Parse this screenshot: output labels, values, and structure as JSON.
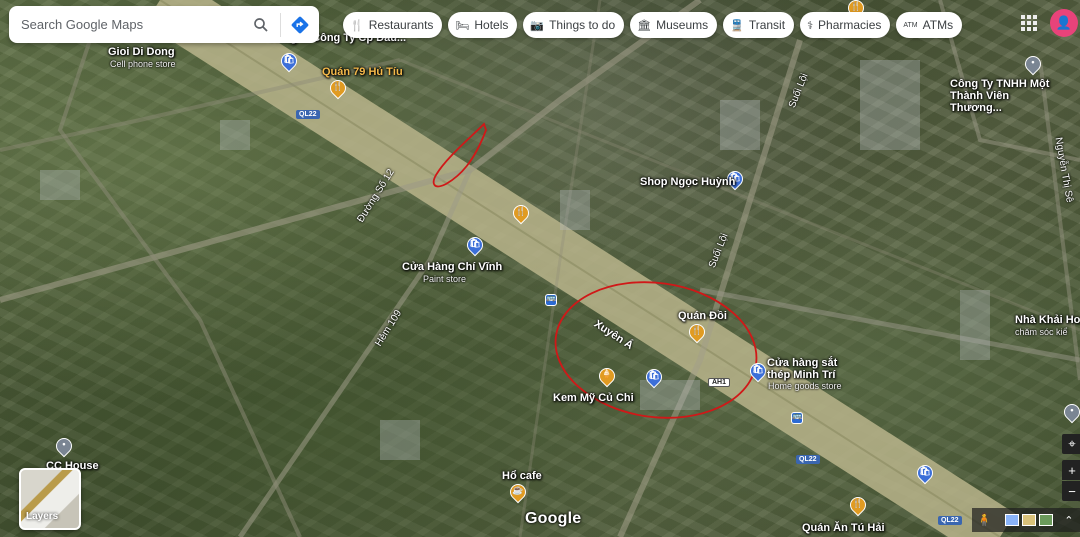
{
  "search": {
    "value": "Search Google Maps"
  },
  "chips": [
    {
      "label": "Restaurants",
      "icon": "fork-knife-icon",
      "glyph": "🍴"
    },
    {
      "label": "Hotels",
      "icon": "bed-icon",
      "glyph": "🛏"
    },
    {
      "label": "Things to do",
      "icon": "camera-icon",
      "glyph": "📷"
    },
    {
      "label": "Museums",
      "icon": "museum-icon",
      "glyph": "🏛"
    },
    {
      "label": "Transit",
      "icon": "train-icon",
      "glyph": "🚆"
    },
    {
      "label": "Pharmacies",
      "icon": "pharmacy-icon",
      "glyph": "⚕"
    },
    {
      "label": "ATMs",
      "icon": "atm-icon",
      "glyph": "ATM"
    }
  ],
  "places": [
    {
      "name": "Quán 79 Hủ Tíu",
      "type": "food"
    },
    {
      "name": "Shop Ngọc Huỳnh",
      "type": "shop"
    },
    {
      "name": "Cửa Hàng Chí Vĩnh",
      "sub": "Paint store",
      "type": "shop"
    },
    {
      "name": "Quán Đồi",
      "type": "food"
    },
    {
      "name": "Cửa hàng sắt thép Minh Trí",
      "sub": "Home goods store",
      "type": "shop"
    },
    {
      "name": "Kem Mỹ Củ Chi",
      "type": "food"
    },
    {
      "name": "Hổ cafe",
      "type": "food"
    },
    {
      "name": "Quán Ăn Tú Hải",
      "type": "food"
    },
    {
      "name": "CC House",
      "type": "gray"
    },
    {
      "name": "Công Ty TNHH Một Thành Viên Thương...",
      "type": "gray"
    },
    {
      "name": "Nhà Khải Hoa",
      "sub": "chăm sóc kiể",
      "type": "gray"
    },
    {
      "name": "Xăng ... Công Ty Cp Đầu...",
      "type": "gray"
    },
    {
      "name": "Gioi Di Dong",
      "sub": "Cell phone store",
      "type": "gray"
    }
  ],
  "streets": {
    "main": "Xuyên Á",
    "duong_so_12": "Đường Số 12",
    "hem_109": "Hẻm 109",
    "suoi_loi": "Suối Lội",
    "suoi_loi_2": "Suối Lội",
    "nguyen_thi": "Nguyễn Thị Sê",
    "shield_ql22": "QL22",
    "shield_ah1": "AH1"
  },
  "layers_label": "Layers",
  "logo": "Google",
  "profile_initial": "👤",
  "colors": {
    "annotation": "#d01818",
    "chip_text": "#3c4043",
    "food_pin": "#e09b22",
    "shop_pin": "#3c6fd8"
  }
}
